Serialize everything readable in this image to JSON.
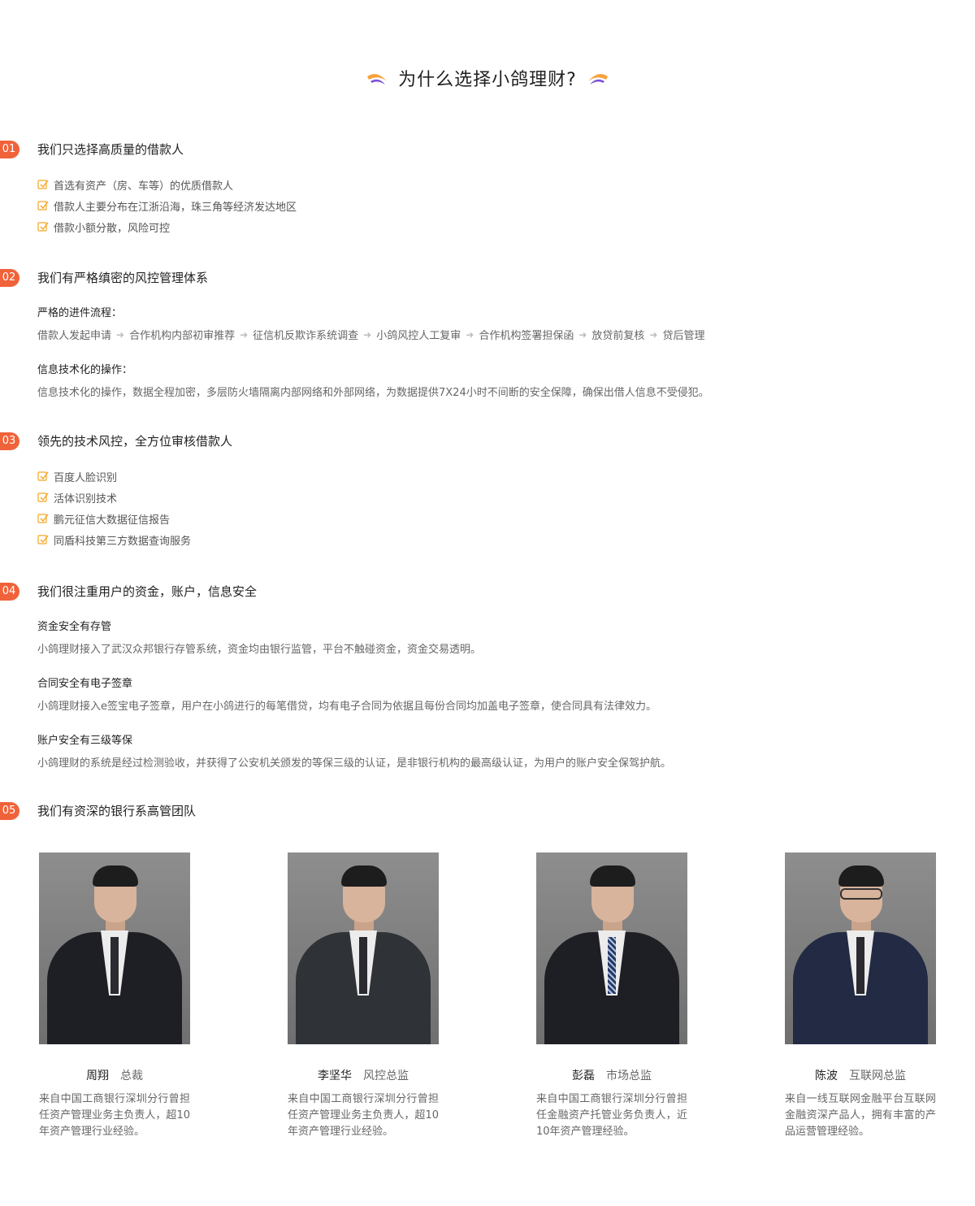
{
  "header": {
    "title": "为什么选择小鸽理财?"
  },
  "colors": {
    "accent": "#f0623a",
    "check": "#f5a623",
    "wing_orange": "#f7a23b",
    "wing_purple": "#7b4fd6"
  },
  "sections": [
    {
      "num": "01",
      "title": "我们只选择高质量的借款人",
      "items": [
        "首选有资产（房、车等）的优质借款人",
        "借款人主要分布在江浙沿海，珠三角等经济发达地区",
        "借款小额分散，风险可控"
      ]
    },
    {
      "num": "02",
      "title": "我们有严格缜密的风控管理体系",
      "process_title": "严格的进件流程：",
      "process_steps": [
        "借款人发起申请",
        "合作机构内部初审推荐",
        "征信机反欺诈系统调查",
        "小鸽风控人工复审",
        "合作机构签署担保函",
        "放贷前复核",
        "贷后管理"
      ],
      "tech_title": "信息技术化的操作：",
      "tech_text": "信息技术化的操作，数据全程加密，多层防火墙隔离内部网络和外部网络，为数据提供7X24小时不间断的安全保障，确保出借人信息不受侵犯。"
    },
    {
      "num": "03",
      "title": "领先的技术风控，全方位审核借款人",
      "items": [
        "百度人脸识别",
        "活体识别技术",
        "鹏元征信大数据征信报告",
        "同盾科技第三方数据查询服务"
      ]
    },
    {
      "num": "04",
      "title": "我们很注重用户的资金，账户，信息安全",
      "blocks": [
        {
          "title": "资金安全有存管",
          "text": "小鸽理财接入了武汉众邦银行存管系统，资金均由银行监管，平台不触碰资金，资金交易透明。"
        },
        {
          "title": "合同安全有电子签章",
          "text": "小鸽理财接入e签宝电子签章，用户在小鸽进行的每笔借贷，均有电子合同为依据且每份合同均加盖电子签章，使合同具有法律效力。"
        },
        {
          "title": "账户安全有三级等保",
          "text": "小鸽理财的系统是经过检测验收，并获得了公安机关颁发的等保三级的认证，是非银行机构的最高级认证，为用户的账户安全保驾护航。"
        }
      ]
    },
    {
      "num": "05",
      "title": "我们有资深的银行系高管团队"
    }
  ],
  "team": [
    {
      "name": "周翔",
      "role": "总裁",
      "bio": "来自中国工商银行深圳分行曾担任资产管理业务主负责人，超10年资产管理行业经验。"
    },
    {
      "name": "李坚华",
      "role": "风控总监",
      "bio": "来自中国工商银行深圳分行曾担任资产管理业务主负责人，超10年资产管理行业经验。"
    },
    {
      "name": "彭磊",
      "role": "市场总监",
      "bio": "来自中国工商银行深圳分行曾担任金融资产托管业务负责人，近10年资产管理经验。"
    },
    {
      "name": "陈波",
      "role": "互联网总监",
      "bio": "来自一线互联网金融平台互联网金融资深产品人，拥有丰富的产品运营管理经验。"
    }
  ]
}
